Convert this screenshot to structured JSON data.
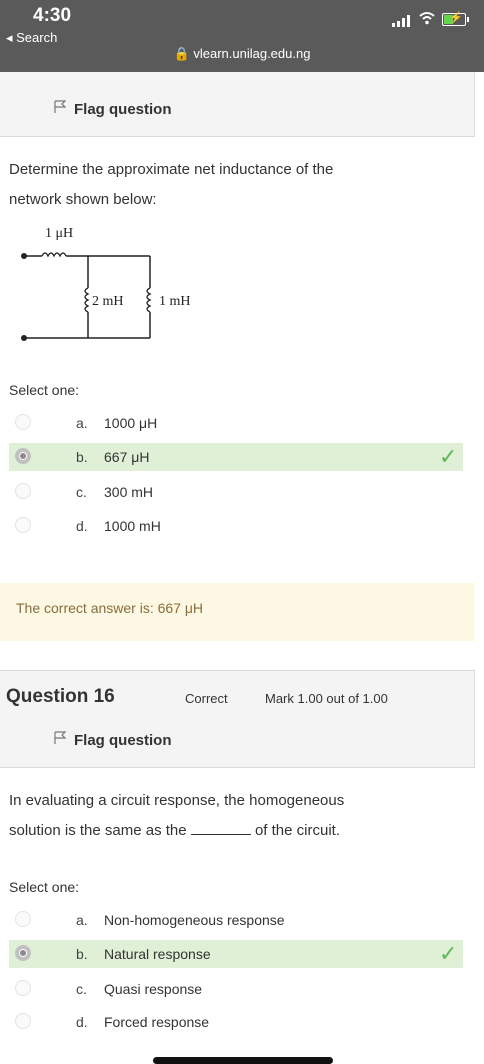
{
  "status_bar": {
    "time": "4:30",
    "back_label": "◂ Search",
    "url": "vlearn.unilag.edu.ng"
  },
  "q15": {
    "flag_label": "Flag question",
    "text_line1": "Determine the approximate net inductance of the",
    "text_line2": "network shown below:",
    "diagram": {
      "series_label": "1 μH",
      "branch1_label": "2 mH",
      "branch2_label": "1 mH"
    },
    "select_one": "Select one:",
    "options": [
      {
        "letter": "a.",
        "text": "1000 μH",
        "selected": false
      },
      {
        "letter": "b.",
        "text": "667 μH",
        "selected": true,
        "correct": true
      },
      {
        "letter": "c.",
        "text": "300 mH",
        "selected": false
      },
      {
        "letter": "d.",
        "text": "1000 mH",
        "selected": false
      }
    ],
    "correct_answer": "The correct answer is: 667 μH"
  },
  "q16": {
    "number": "Question 16",
    "state": "Correct",
    "mark": "Mark 1.00 out of 1.00",
    "flag_label": "Flag question",
    "text_line1": "In evaluating a circuit response, the homogeneous",
    "text_line2_before": "solution is the same as the",
    "text_line2_after": "of the circuit.",
    "select_one": "Select one:",
    "options": [
      {
        "letter": "a.",
        "text": "Non-homogeneous response",
        "selected": false
      },
      {
        "letter": "b.",
        "text": "Natural response",
        "selected": true,
        "correct": true
      },
      {
        "letter": "c.",
        "text": "Quasi response",
        "selected": false
      },
      {
        "letter": "d.",
        "text": "Forced response",
        "selected": false
      }
    ]
  },
  "colors": {
    "correct_bg": "#e0f0d6",
    "check": "#5cb85c",
    "answer_bg": "#fcf8e3",
    "answer_text": "#8a6d3b"
  }
}
